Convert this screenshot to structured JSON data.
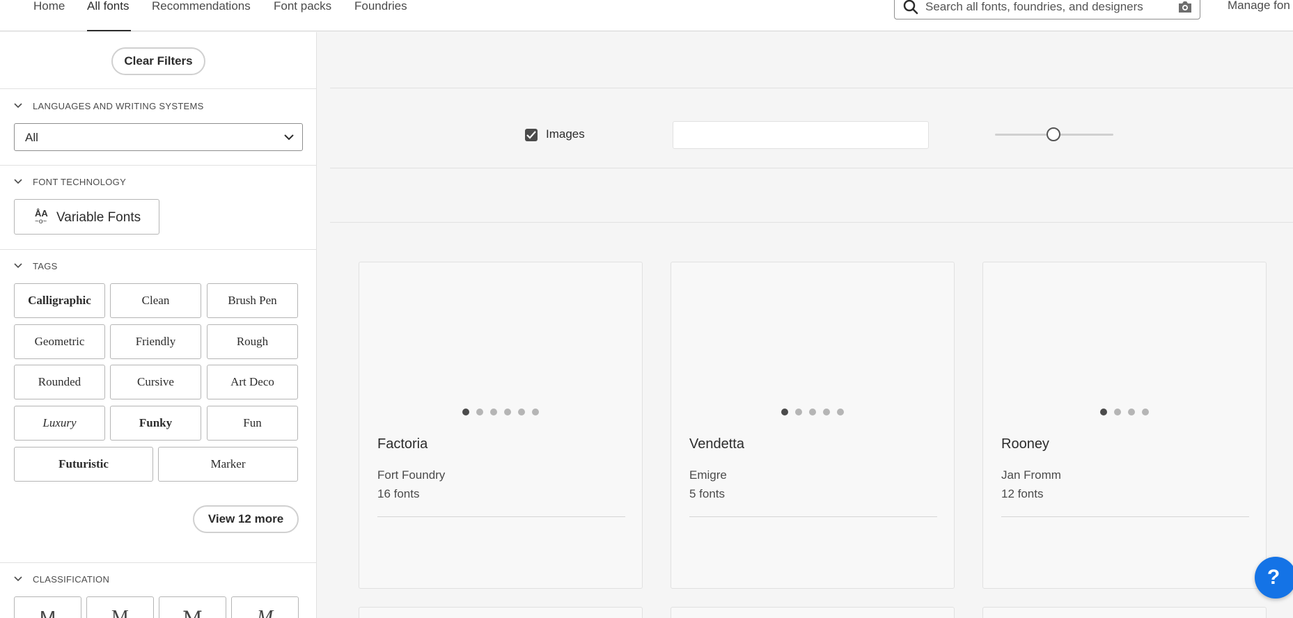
{
  "nav": {
    "links": [
      "Home",
      "All fonts",
      "Recommendations",
      "Font packs",
      "Foundries"
    ],
    "active": "All fonts",
    "search_placeholder": "Search all fonts, foundries, and designers",
    "manage": "Manage fon"
  },
  "sidebar": {
    "clear_filters": "Clear Filters",
    "languages": {
      "title": "LANGUAGES AND WRITING SYSTEMS",
      "selected": "All"
    },
    "technology": {
      "title": "FONT TECHNOLOGY",
      "variable_label": "Variable Fonts",
      "variable_icon": "variable-font-icon"
    },
    "tags": {
      "title": "TAGS",
      "items": [
        "Calligraphic",
        "Clean",
        "Brush Pen",
        "Geometric",
        "Friendly",
        "Rough",
        "Rounded",
        "Cursive",
        "Art Deco",
        "Luxury",
        "Funky",
        "Fun",
        "Futuristic",
        "Marker"
      ],
      "view_more": "View 12 more"
    },
    "classification": {
      "title": "CLASSIFICATION",
      "glyphs": [
        "M",
        "M",
        "M",
        "M"
      ]
    }
  },
  "toolbar": {
    "images_label": "Images",
    "images_checked": true,
    "preview_text": "",
    "size_slider_fraction": 0.42
  },
  "cards": [
    {
      "name": "Factoria",
      "foundry": "Fort Foundry",
      "count": "16 fonts",
      "dots": 6
    },
    {
      "name": "Vendetta",
      "foundry": "Emigre",
      "count": "5 fonts",
      "dots": 5
    },
    {
      "name": "Rooney",
      "foundry": "Jan Fromm",
      "count": "12 fonts",
      "dots": 4
    }
  ],
  "help": {
    "label": "?"
  },
  "colors": {
    "accent": "#1473e6",
    "text": "#2c2c2c",
    "muted": "#4b4b4b",
    "background": "#f5f5f5"
  }
}
